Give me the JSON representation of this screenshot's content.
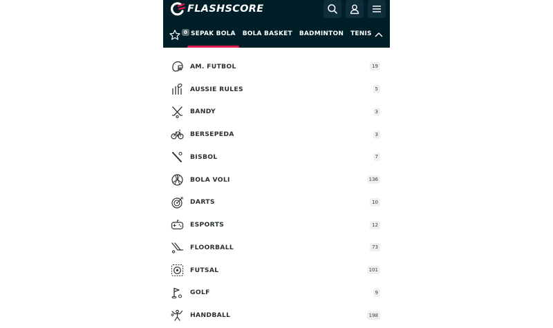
{
  "app": {
    "brand": "FLASHSCORE"
  },
  "header": {
    "search_icon": "search-icon",
    "user_icon": "user-icon",
    "menu_icon": "hamburger-menu-icon"
  },
  "favorites": {
    "count": "0"
  },
  "tabs": [
    {
      "label": "SEPAK BOLA",
      "active": true
    },
    {
      "label": "BOLA BASKET",
      "active": false
    },
    {
      "label": "BADMINTON",
      "active": false
    },
    {
      "label": "TENIS",
      "active": false
    }
  ],
  "sports": [
    {
      "label": "AM. FUTBOL",
      "count": "19",
      "icon": "american-football-icon"
    },
    {
      "label": "AUSSIE RULES",
      "count": "5",
      "icon": "aussie-rules-icon"
    },
    {
      "label": "BANDY",
      "count": "3",
      "icon": "bandy-icon"
    },
    {
      "label": "BERSEPEDA",
      "count": "3",
      "icon": "cycling-icon"
    },
    {
      "label": "BISBOL",
      "count": "7",
      "icon": "baseball-icon"
    },
    {
      "label": "BOLA VOLI",
      "count": "136",
      "icon": "volleyball-icon"
    },
    {
      "label": "DARTS",
      "count": "10",
      "icon": "darts-icon"
    },
    {
      "label": "ESPORTS",
      "count": "12",
      "icon": "esports-icon"
    },
    {
      "label": "FLOORBALL",
      "count": "73",
      "icon": "floorball-icon"
    },
    {
      "label": "FUTSAL",
      "count": "101",
      "icon": "futsal-icon"
    },
    {
      "label": "GOLF",
      "count": "9",
      "icon": "golf-icon"
    },
    {
      "label": "HANDBALL",
      "count": "198",
      "icon": "handball-icon"
    }
  ],
  "colors": {
    "header_bg": "#001e28",
    "accent": "#dd1a4e",
    "text": "#2a2f33"
  }
}
